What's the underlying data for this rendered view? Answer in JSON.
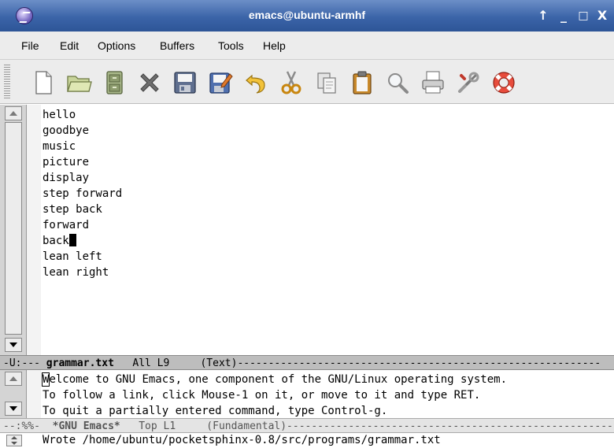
{
  "window": {
    "title": "emacs@ubuntu-armhf",
    "controls": [
      "↑",
      "_",
      "□",
      "X"
    ]
  },
  "menubar": {
    "items": [
      "File",
      "Edit",
      "Options",
      "Buffers",
      "Tools",
      "Help"
    ]
  },
  "toolbar": {
    "buttons": [
      {
        "icon": "new-file-icon"
      },
      {
        "icon": "open-folder-icon"
      },
      {
        "icon": "open-directory-icon"
      },
      {
        "icon": "close-buffer-icon"
      },
      {
        "icon": "save-icon"
      },
      {
        "icon": "save-as-icon"
      },
      {
        "icon": "undo-icon"
      },
      {
        "icon": "cut-icon"
      },
      {
        "icon": "copy-icon"
      },
      {
        "icon": "paste-icon"
      },
      {
        "icon": "search-icon"
      },
      {
        "icon": "print-icon"
      },
      {
        "icon": "preferences-icon"
      },
      {
        "icon": "help-icon"
      }
    ]
  },
  "buffer": {
    "lines": [
      "hello",
      "goodbye",
      "music",
      "picture",
      "display",
      "step forward",
      "step back",
      "forward",
      "back",
      "lean left",
      "lean right"
    ],
    "cursor_line": 8
  },
  "modeline_main": {
    "prefix": "-U:--- ",
    "buffer_name": "grammar.txt",
    "position": "   All L9     ",
    "mode": "(Text)",
    "fill": "-----------------------------------------------------------"
  },
  "help": {
    "first_char": "W",
    "line1_rest": "elcome to GNU Emacs, one component of the GNU/Linux operating system.",
    "line2": "To follow a link, click Mouse-1 on it, or move to it and type RET.",
    "line3": "To quit a partially entered command, type Control-g."
  },
  "modeline_help": {
    "prefix": "--:%%-  ",
    "buffer_name": "*GNU Emacs*",
    "position": "   Top L1     ",
    "mode": "(Fundamental)",
    "fill": "-----------------------------------------------------"
  },
  "echo_area": {
    "message": "Wrote /home/ubuntu/pocketsphinx-0.8/src/programs/grammar.txt"
  },
  "colors": {
    "titlebar": "#3b64a8",
    "modeline_active": "#bdbdbd",
    "modeline_inactive": "#e4e4e4"
  }
}
